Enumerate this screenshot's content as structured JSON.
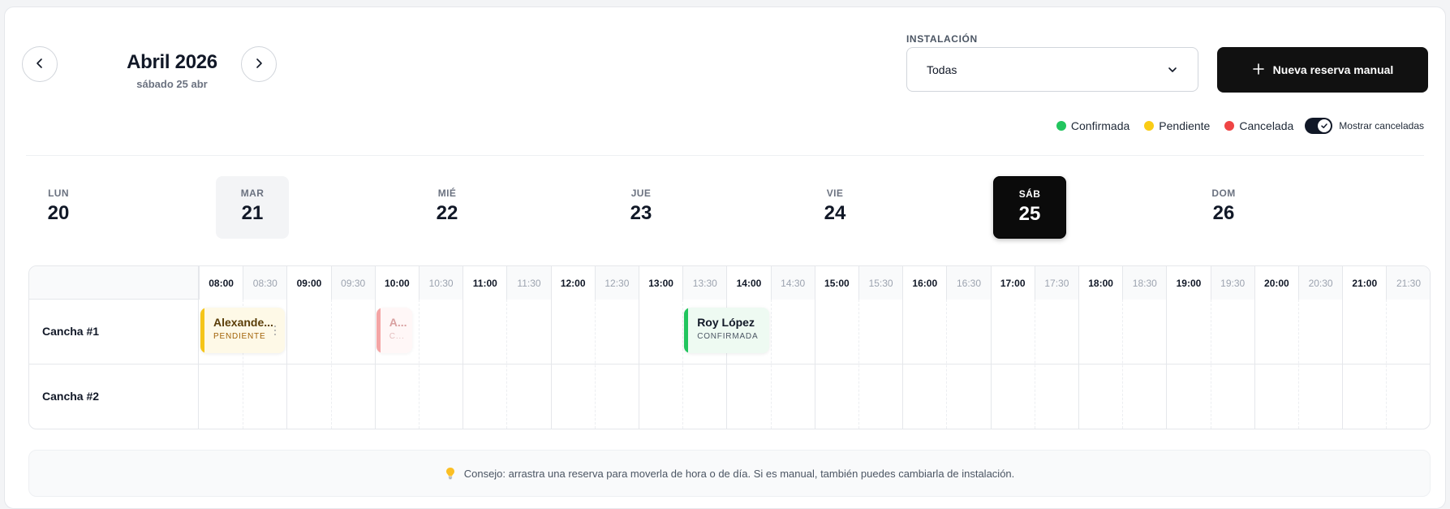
{
  "header": {
    "month_title": "Abril 2026",
    "selected_date": "sábado 25 abr",
    "prev_icon": "chevron-left-icon",
    "next_icon": "chevron-right-icon"
  },
  "installation": {
    "label": "INSTALACIÓN",
    "selected": "Todas"
  },
  "new_booking_button": {
    "label": "Nueva reserva manual",
    "icon": "plus-icon"
  },
  "legend": {
    "items": [
      {
        "label": "Confirmada",
        "color": "#22c55e"
      },
      {
        "label": "Pendiente",
        "color": "#facc15"
      },
      {
        "label": "Cancelada",
        "color": "#ef4444"
      }
    ],
    "toggle_label": "Mostrar canceladas",
    "toggle_on": true
  },
  "week": [
    {
      "name": "LUN",
      "num": "20"
    },
    {
      "name": "MAR",
      "num": "21",
      "today": true
    },
    {
      "name": "MIÉ",
      "num": "22"
    },
    {
      "name": "JUE",
      "num": "23"
    },
    {
      "name": "VIE",
      "num": "24"
    },
    {
      "name": "SÁB",
      "num": "25",
      "selected": true
    },
    {
      "name": "DOM",
      "num": "26"
    }
  ],
  "times": [
    "08:00",
    "08:30",
    "09:00",
    "09:30",
    "10:00",
    "10:30",
    "11:00",
    "11:30",
    "12:00",
    "12:30",
    "13:00",
    "13:30",
    "14:00",
    "14:30",
    "15:00",
    "15:30",
    "16:00",
    "16:30",
    "17:00",
    "17:30",
    "18:00",
    "18:30",
    "19:00",
    "19:30",
    "20:00",
    "20:30",
    "21:00",
    "21:30"
  ],
  "courts": [
    {
      "name": "Cancha #1"
    },
    {
      "name": "Cancha #2"
    }
  ],
  "bookings": [
    {
      "name": "Alexande...",
      "status": "PENDIENTE",
      "type": "pending",
      "court": 0,
      "start": "08:00",
      "end": "09:00"
    },
    {
      "name": "A...",
      "status": "C...",
      "type": "cancelled",
      "court": 0,
      "start": "10:00",
      "end": "10:30"
    },
    {
      "name": "Roy López",
      "status": "CONFIRMADA",
      "type": "confirmed",
      "court": 0,
      "start": "13:30",
      "end": "14:30"
    }
  ],
  "tip": {
    "icon": "lightbulb-icon",
    "text": "Consejo: arrastra una reserva para moverla de hora o de día. Si es manual, también puedes cambiarla de instalación."
  }
}
